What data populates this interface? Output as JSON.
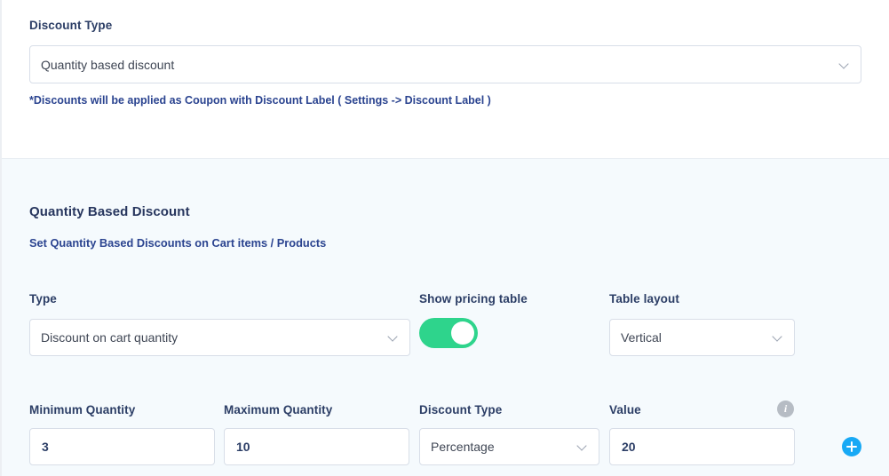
{
  "discount_type_section": {
    "label": "Discount Type",
    "selected": "Quantity based discount",
    "chevron_icon": "chevron-down-icon",
    "hint": "*Discounts will be applied as Coupon with Discount Label ( Settings -> Discount Label )"
  },
  "quantity_section": {
    "title": "Quantity Based Discount",
    "subtitle": "Set Quantity Based Discounts on Cart items / Products",
    "type": {
      "label": "Type",
      "selected": "Discount on cart quantity"
    },
    "show_pricing_table": {
      "label": "Show pricing table",
      "state": "on"
    },
    "table_layout": {
      "label": "Table layout",
      "selected": "Vertical"
    }
  },
  "tier_row": {
    "minimum_quantity": {
      "label": "Minimum Quantity",
      "value": "3"
    },
    "maximum_quantity": {
      "label": "Maximum Quantity",
      "value": "10"
    },
    "discount_type": {
      "label": "Discount Type",
      "selected": "Percentage"
    },
    "value": {
      "label": "Value",
      "value": "20",
      "info_icon": "info-icon",
      "info_glyph": "i"
    },
    "add_button": {
      "icon": "plus-icon"
    }
  },
  "colors": {
    "label_navy": "#2c3e66",
    "link_blue": "#2b4490",
    "toggle_green": "#2ed48c",
    "add_blue": "#18a9f5",
    "panel_tint": "#f5fafd",
    "border_gray": "#d8dee8"
  }
}
